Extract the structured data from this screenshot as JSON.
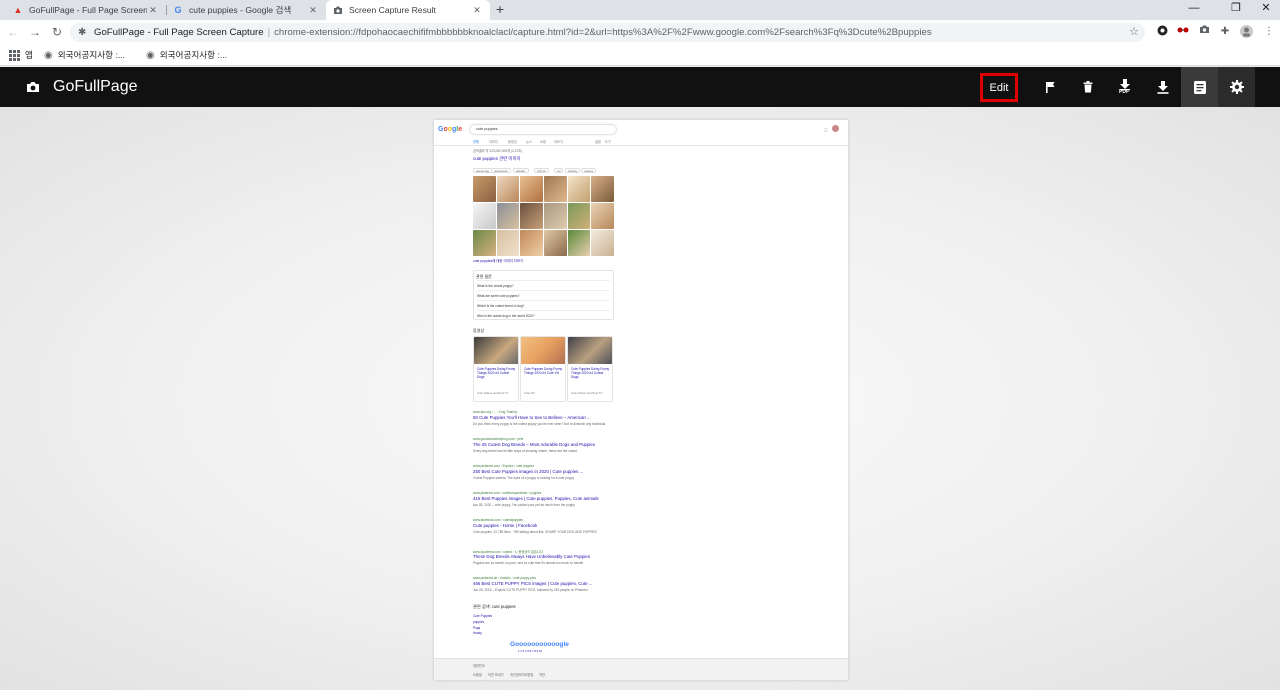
{
  "browser": {
    "tabs": [
      {
        "title": "GoFullPage - Full Page Screen C",
        "favicon": "gofullpage-favicon",
        "active": false
      },
      {
        "title": "cute puppies - Google 검색",
        "favicon": "google-favicon",
        "active": false
      },
      {
        "title": "Screen Capture Result",
        "favicon": "camera-favicon",
        "active": true
      }
    ],
    "new_tab": "+",
    "window_controls": {
      "minimize": "—",
      "maximize": "❐",
      "close": "✕"
    }
  },
  "address_bar": {
    "site_name": "GoFullPage - Full Page Screen Capture",
    "url": "chrome-extension://fdpohaocaechififmbbbbbbknoalclacl/capture.html?id=2&url=https%3A%2F%2Fwww.google.com%2Fsearch%3Fq%3Dcute%2Bpuppies"
  },
  "bookmarks": {
    "apps_label": "앱",
    "items": [
      "외국어공지사항 :...",
      "외국어공지사항 :..."
    ]
  },
  "app": {
    "name": "GoFullPage",
    "toolbar": {
      "edit_label": "Edit",
      "pdf_label": "PDF",
      "icons": [
        "camera-icon",
        "flag-icon",
        "trash-icon",
        "download-pdf-icon",
        "download-icon",
        "file-list-icon",
        "gear-icon"
      ]
    }
  },
  "preview": {
    "search_query": "cute puppies",
    "tabs": [
      "전체",
      "이미지",
      "동영상",
      "뉴스",
      "쇼핑",
      "더보기",
      "설정",
      "도구"
    ],
    "result_count": "검색결과 약 123,000,000개 (0.47초)",
    "images_heading": "cute puppies 관련 이미지",
    "image_chips": [
      "teacup dog",
      "pomeranian",
      "labrador",
      "shih tzu",
      "cat",
      "drawing",
      "maltese"
    ],
    "images_more": "cute puppies에 대한 이미지 더보기",
    "paa_heading": "관련 질문",
    "paa_questions": [
      "What is the cutest puppy?",
      "What are some cute puppies?",
      "Which is the cutest breed of dog?",
      "Who is the cutest dog in the world 2020?"
    ],
    "videos_heading": "동영상",
    "videos": [
      {
        "title": "Cute Puppies Doing Funny Things 2020 #4 Cutest Dogs",
        "source": "Cute Videos and Pets TV"
      },
      {
        "title": "Cute Puppies Doing Funny Things 2020 #4 Cute VN",
        "source": "Cute VN"
      },
      {
        "title": "Cute Puppies Doing Funny Things 2020 #4 Cutest Dogs",
        "source": "Cute Videos and Pets TV"
      }
    ],
    "results": [
      {
        "cite": "www.akc.org › ... › Dog Training",
        "title": "50 Cute Puppies You'll Have to See to Believe – American ...",
        "snippet": "Do you think every puppy is the cutest puppy you've ever seen? Not to diminish any individual"
      },
      {
        "cite": "www.goodhousekeeping.com › pets",
        "title": "The 25 Cutest Dog Breeds – Most Adorable Dogs and Puppies",
        "snippet": "Every dog breed has its little ways of showing charm, these are the cutest"
      },
      {
        "cite": "www.pinterest.com › Explore › cute puppies",
        "title": "250 Best Cute Puppies images in 2020 | Cute puppies ...",
        "snippet": "Cutest Puppies sweets, The eyes of a puppy is looking for a cute puppy"
      },
      {
        "cite": "www.pinterest.com › cutefunnyanimals › puppies",
        "title": "416 Best Puppies images | Cute puppies, Puppies, Cute animals",
        "snippet": "Apr 28, 2020 – cute puppy, You picked your pet as much from the puppy"
      },
      {
        "cite": "www.facebook.com › cutestpuppies",
        "title": "Cute puppies - Home | Facebook",
        "snippet": "Cute puppies. 22,789 likes · 789 talking about this. SHARE YOUR DOG AND PUPPIES"
      },
      {
        "cite": "www.buzzfeed.com › cutest › 시 동영상이 없습니다",
        "title": "These Dog Breeds Always Have Unbelievably Cute Puppies",
        "snippet": "Puppies are so sweet, so pure, and so cute that it's almost too much to handle"
      },
      {
        "cite": "www.pinterest.de › tomotio › cute-puppy-pics",
        "title": "466 Best CUTE PUPPY PICS images | Cute puppies, Cute ...",
        "snippet": "Jun 28, 2019 – Explore CUTE PUPPY PICS, followed by 245 people on Pinterest"
      }
    ],
    "related_heading": "관련 검색: cute puppies",
    "related": [
      "Cute Puppies",
      "puppies",
      "Pugs",
      "Husky"
    ],
    "pagination": "Gooooooooooogle",
    "pagination_pages": "1 2 3 4 5 6 7 8 9 10",
    "footer_country": "대한민국",
    "footer_links": [
      "도움말",
      "의견 보내기",
      "개인정보처리방침",
      "약관"
    ]
  }
}
